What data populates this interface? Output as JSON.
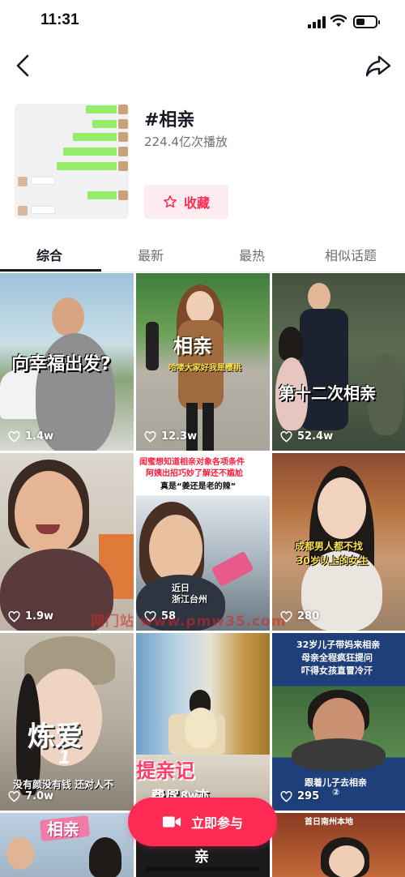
{
  "status_bar": {
    "time": "11:31",
    "battery_level": 0.45
  },
  "topic": {
    "title": "#相亲",
    "plays": "224.4亿次播放",
    "collect_label": "收藏"
  },
  "tabs": [
    {
      "label": "综合",
      "active": true
    },
    {
      "label": "最新",
      "active": false
    },
    {
      "label": "最热",
      "active": false
    },
    {
      "label": "相似话题",
      "active": false
    }
  ],
  "videos": [
    {
      "likes": "1.4w",
      "caption": "向幸福出发?"
    },
    {
      "likes": "12.3w",
      "caption": "相亲",
      "subcaption": "哈喽大家好我是樱桃"
    },
    {
      "likes": "52.4w",
      "caption": "第十二次相亲"
    },
    {
      "likes": "1.9w",
      "caption": ""
    },
    {
      "likes": "58",
      "caption": "闺蜜想知道相亲对象各项条件",
      "line2": "阿姨出招巧妙了解还不尴尬",
      "line3": "真是“姜还是老的辣”",
      "location": "近日\n浙江台州"
    },
    {
      "likes": "280",
      "caption": "成都男人都不找",
      "line2": "30岁以上的女生"
    },
    {
      "likes": "7.0w",
      "caption": "炼爱",
      "number": "1",
      "bottom": "没有颜没有钱 还对人不"
    },
    {
      "likes": "5.8w",
      "caption": "提亲记",
      "bottom": "费尽心迹"
    },
    {
      "likes": "295",
      "caption": "32岁儿子带妈来相亲",
      "line2": "母亲全程疯狂提问",
      "line3": "吓得女孩直冒冷汗",
      "series": "跟着儿子去相亲",
      "series_num": "②"
    },
    {
      "likes": "",
      "caption": "相亲"
    },
    {
      "likes": "",
      "caption": "亲"
    },
    {
      "likes": "",
      "caption": "首日南州本地"
    }
  ],
  "watermark": "网门站 www.pmw35.com",
  "cta": {
    "label": "立即参与"
  },
  "colors": {
    "accent": "#fe2c55",
    "text": "#161823",
    "secondary": "#6d6f77"
  }
}
